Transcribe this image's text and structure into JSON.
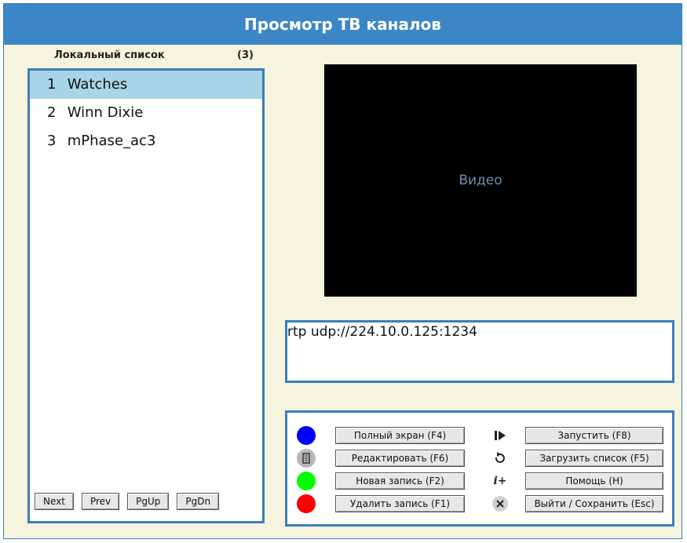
{
  "title": "Просмотр ТВ каналов",
  "list": {
    "header": "Локальный список",
    "count": "(3)",
    "items": [
      {
        "num": "1",
        "name": "Watches",
        "selected": true
      },
      {
        "num": "2",
        "name": "Winn Dixie",
        "selected": false
      },
      {
        "num": "3",
        "name": "mPhase_ac3",
        "selected": false
      }
    ],
    "nav": [
      "Next",
      "Prev",
      "PgUp",
      "PgDn"
    ]
  },
  "video": {
    "label": "Видео"
  },
  "stream_url": "rtp udp://224.10.0.125:1234",
  "controls": {
    "left": [
      {
        "label": "Полный экран (F4)",
        "icon": "blue-dot-icon",
        "color": "#0000ff"
      },
      {
        "label": "Редактировать (F6)",
        "icon": "edit-doc-icon",
        "color": "#888888"
      },
      {
        "label": "Новая запись (F2)",
        "icon": "green-dot-icon",
        "color": "#00ff00"
      },
      {
        "label": "Удалить запись (F1)",
        "icon": "red-dot-icon",
        "color": "#ff0000"
      }
    ],
    "right": [
      {
        "label": "Запустить (F8)",
        "icon": "play-icon",
        "glyph": "▶"
      },
      {
        "label": "Загрузить список (F5)",
        "icon": "reload-icon",
        "glyph": "↺"
      },
      {
        "label": "Помощь (H)",
        "icon": "info-icon",
        "glyph": "i+"
      },
      {
        "label": "Выйти / Сохранить (Esc)",
        "icon": "close-icon",
        "glyph": "✕"
      }
    ]
  },
  "colors": {
    "accent": "#3d86c6",
    "background": "#f6f4de",
    "selection": "#a8d4e8"
  }
}
